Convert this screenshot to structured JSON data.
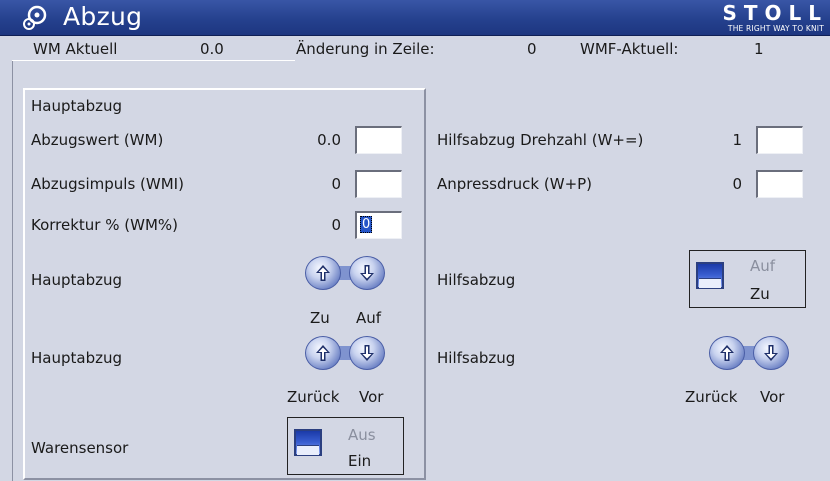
{
  "window": {
    "title": "Abzug",
    "brand_name": "STOLL",
    "brand_tagline": "THE RIGHT WAY TO KNIT"
  },
  "info": {
    "wm_label": "WM Aktuell",
    "wm_value": "0.0",
    "change_label": "Änderung in Zeile:",
    "change_value": "0",
    "wmf_label": "WMF-Aktuell:",
    "wmf_value": "1"
  },
  "left": {
    "panel_title": "Hauptabzug",
    "abzugswert_label": "Abzugswert (WM)",
    "abzugswert_value": "0.0",
    "abzugsimpuls_label": "Abzugsimpuls (WMI)",
    "abzugsimpuls_value": "0",
    "korrektur_label": "Korrektur % (WM%)",
    "korrektur_value": "0",
    "korrektur_input": "0",
    "haupt1_label": "Hauptabzug",
    "haupt1_up": "Zu",
    "haupt1_down": "Auf",
    "haupt2_label": "Hauptabzug",
    "haupt2_up": "Zurück",
    "haupt2_down": "Vor",
    "warensensor_label": "Warensensor",
    "warensensor_off": "Aus",
    "warensensor_on": "Ein"
  },
  "right": {
    "drehzahl_label": "Hilfsabzug Drehzahl (W+=)",
    "drehzahl_value": "1",
    "anpress_label": "Anpressdruck (W+P)",
    "anpress_value": "0",
    "hilfs1_label": "Hilfsabzug",
    "hilfs1_off": "Auf",
    "hilfs1_on": "Zu",
    "hilfs2_label": "Hilfsabzug",
    "hilfs2_up": "Zurück",
    "hilfs2_down": "Vor"
  },
  "icons": {
    "app": "pulley-icon",
    "up": "arrow-up-icon",
    "down": "arrow-down-icon",
    "toggle": "toggle-switch-icon"
  },
  "colors": {
    "titlebar": "#25418e",
    "background": "#d3d7e4",
    "accent": "#2454c8"
  }
}
